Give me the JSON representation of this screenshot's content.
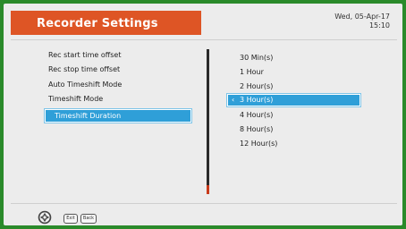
{
  "header": {
    "title": "Recorder Settings",
    "date": "Wed, 05-Apr-17",
    "time": "15:10",
    "accent_color": "#de5525"
  },
  "menu": {
    "items": [
      {
        "label": "Rec start time offset"
      },
      {
        "label": "Rec stop time offset"
      },
      {
        "label": "Auto Timeshift Mode"
      },
      {
        "label": "Timeshift Mode"
      },
      {
        "label": "Timeshift Duration"
      }
    ],
    "selected_index": 4
  },
  "options": {
    "items": [
      {
        "label": "30 Min(s)"
      },
      {
        "label": "1 Hour"
      },
      {
        "label": "2 Hour(s)"
      },
      {
        "label": "3 Hour(s)"
      },
      {
        "label": "4 Hour(s)"
      },
      {
        "label": "8 Hour(s)"
      },
      {
        "label": "12 Hour(s)"
      }
    ],
    "selected_index": 3,
    "selected_marker": "‹",
    "highlight_color": "#2f9fd8"
  },
  "footer": {
    "icons": [
      "navigation-wheel-icon"
    ],
    "keys": [
      {
        "label": "Exit"
      },
      {
        "label": "Back"
      }
    ]
  }
}
